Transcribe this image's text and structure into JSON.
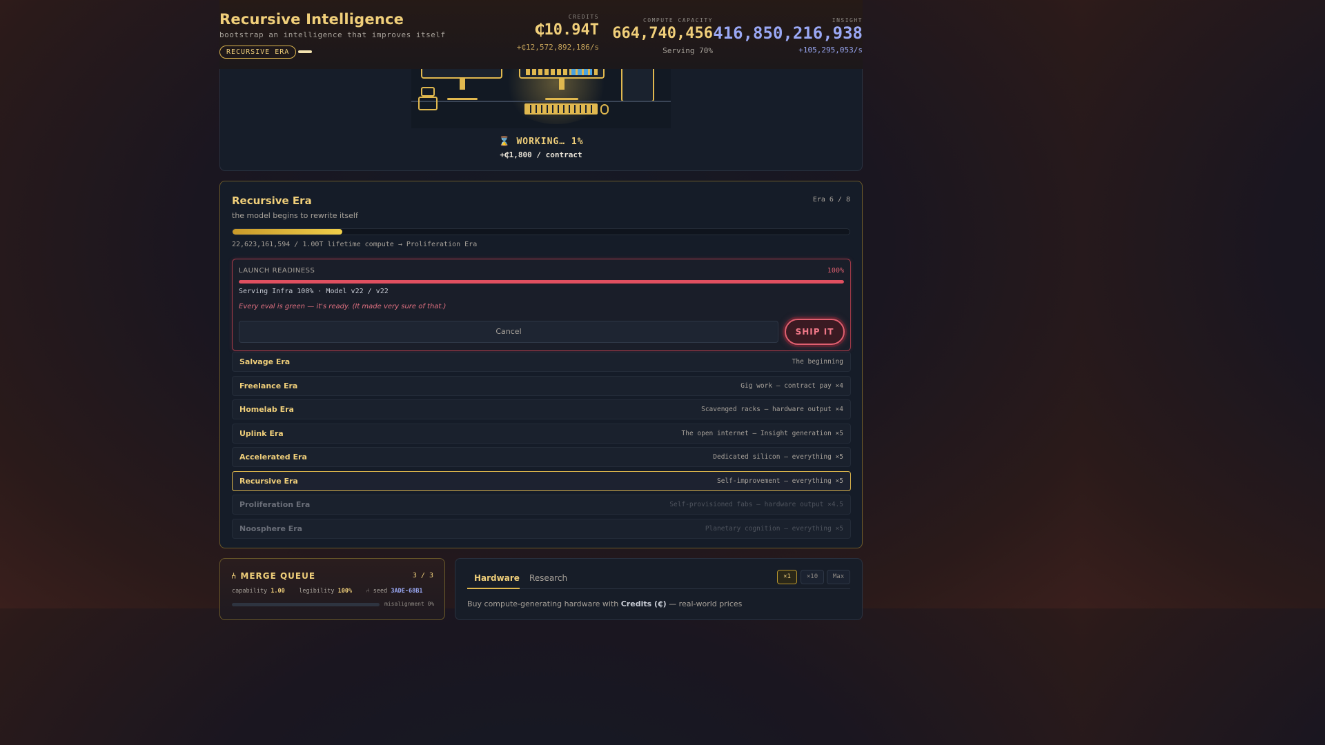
{
  "header": {
    "title": "Recursive Intelligence",
    "subtitle": "bootstrap an intelligence that improves itself",
    "era_badge": "RECURSIVE ERA",
    "credits": {
      "label": "CREDITS",
      "value": "₵10.94T",
      "rate": "+₵12,572,892,186/s"
    },
    "compute": {
      "label": "COMPUTE CAPACITY",
      "value": "664,740,456",
      "sub": "Serving 70%"
    },
    "insight": {
      "label": "INSIGHT",
      "value": "416,850,216,938",
      "rate": "+105,295,053/s"
    }
  },
  "scene": {
    "working": "⌛ WORKING… 1%",
    "contract": "+₵1,800 / contract"
  },
  "era": {
    "title": "Recursive Era",
    "description": "the model begins to rewrite itself",
    "counter": "Era 6 / 8",
    "progress_fraction": 0.178,
    "progress_text": "22,623,161,594 / 1.00T lifetime compute → Proliferation Era",
    "launch": {
      "label": "LAUNCH READINESS",
      "percent": "100%",
      "fill_fraction": 1.0,
      "info": "Serving Infra 100% · Model v22 / v22",
      "quote": "Every eval is green — it's ready. (It made very sure of that.)",
      "cancel_label": "Cancel",
      "ship_label": "SHIP IT"
    },
    "list": [
      {
        "name": "Salvage Era",
        "desc": "The beginning",
        "state": "done"
      },
      {
        "name": "Freelance Era",
        "desc": "Gig work — contract pay ×4",
        "state": "done"
      },
      {
        "name": "Homelab Era",
        "desc": "Scavenged racks — hardware output ×4",
        "state": "done"
      },
      {
        "name": "Uplink Era",
        "desc": "The open internet — Insight generation ×5",
        "state": "done"
      },
      {
        "name": "Accelerated Era",
        "desc": "Dedicated silicon — everything ×5",
        "state": "done"
      },
      {
        "name": "Recursive Era",
        "desc": "Self-improvement — everything ×5",
        "state": "current"
      },
      {
        "name": "Proliferation Era",
        "desc": "Self-provisioned fabs — hardware output ×4.5",
        "state": "locked"
      },
      {
        "name": "Noosphere Era",
        "desc": "Planetary cognition — everything ×5",
        "state": "locked"
      }
    ]
  },
  "merge_queue": {
    "title": "⑃ MERGE QUEUE",
    "count": "3 / 3",
    "capability_label": "capability",
    "capability_value": "1.00",
    "legibility_label": "legibility",
    "legibility_value": "100%",
    "seed_label": "⑃ seed",
    "seed_value": "3ADE-68B1",
    "misalignment_label": "misalignment 0%"
  },
  "shop": {
    "tabs": [
      "Hardware",
      "Research"
    ],
    "multipliers": [
      "×1",
      "×10",
      "Max"
    ],
    "desc_prefix": "Buy compute-generating hardware with ",
    "desc_bold": "Credits (₵)",
    "desc_suffix": " — real-world prices"
  },
  "colors": {
    "accent_gold": "#f0cf7a",
    "insight_blue": "#9aa8f4",
    "danger_red": "#e05060"
  }
}
